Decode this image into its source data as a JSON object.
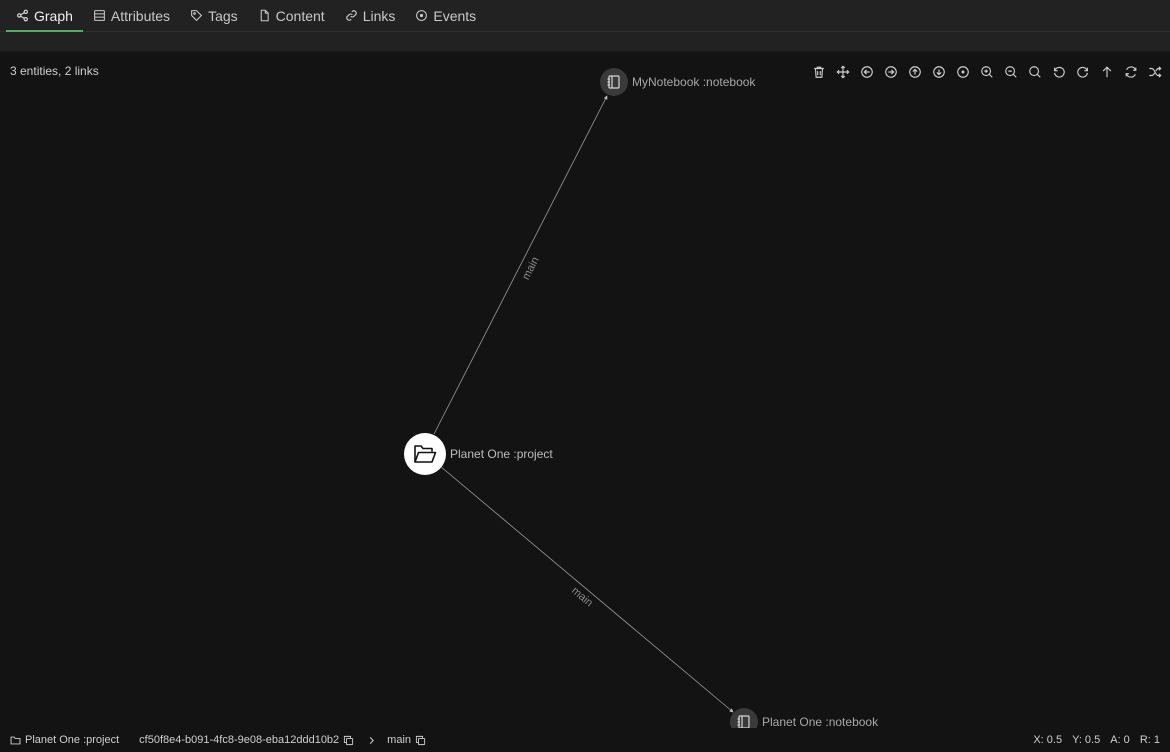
{
  "tabs": [
    {
      "label": "Graph",
      "icon": "share-icon",
      "active": true
    },
    {
      "label": "Attributes",
      "icon": "table-icon"
    },
    {
      "label": "Tags",
      "icon": "tag-icon"
    },
    {
      "label": "Content",
      "icon": "file-icon"
    },
    {
      "label": "Links",
      "icon": "link-icon"
    },
    {
      "label": "Events",
      "icon": "circle-dot-icon"
    }
  ],
  "graph": {
    "summary": "3 entities, 2 links",
    "nodes": [
      {
        "label": "Planet One :project",
        "icon": "folder-open-icon",
        "kind": "project"
      },
      {
        "label": "MyNotebook :notebook",
        "icon": "notebook-icon",
        "kind": "notebook"
      },
      {
        "label": "Planet One :notebook",
        "icon": "notebook-icon",
        "kind": "notebook"
      }
    ],
    "links": [
      {
        "label": "main"
      },
      {
        "label": "main"
      }
    ]
  },
  "toolbar": [
    "trash-icon",
    "move-icon",
    "arrow-left-circle-icon",
    "arrow-right-circle-icon",
    "arrow-up-circle-icon",
    "arrow-down-circle-icon",
    "target-icon",
    "zoom-in-icon",
    "zoom-out-icon",
    "search-icon",
    "rotate-ccw-icon",
    "rotate-cw-icon",
    "arrow-up-icon",
    "refresh-icon",
    "shuffle-icon"
  ],
  "status": {
    "entity": "Planet One :project",
    "id": "cf50f8e4-b091-4fc8-9e08-eba12ddd10b2",
    "branch": "main",
    "x": "X: 0.5",
    "y": "Y: 0.5",
    "a": "A: 0",
    "r": "R: 1"
  },
  "colors": {
    "accent": "#4fb061",
    "background": "#131313",
    "tabbar": "#222222"
  }
}
